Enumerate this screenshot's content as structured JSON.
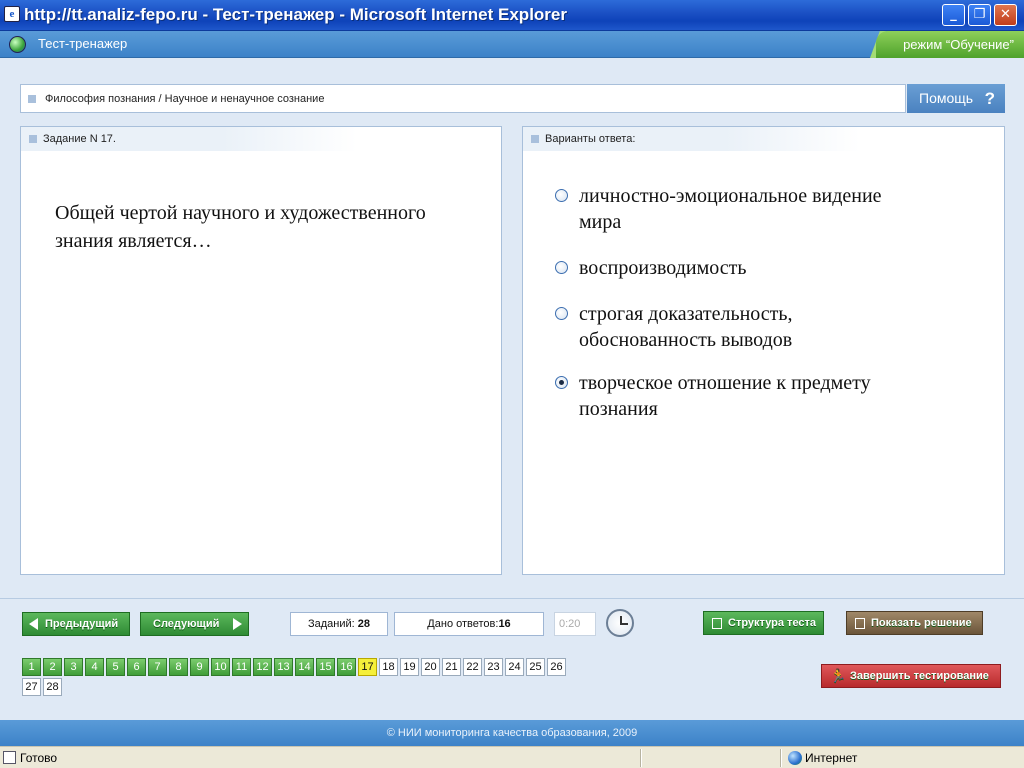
{
  "window": {
    "title": "http://tt.analiz-fepo.ru - Тест-тренажер - Microsoft Internet Explorer",
    "icon": "ie-page-icon"
  },
  "app": {
    "title": "Тест-тренажер",
    "mode": "режим “Обучение”"
  },
  "breadcrumb": "Философия познания / Научное и ненаучное сознание",
  "help_label": "Помощь",
  "help_icon": "?",
  "task": {
    "header": "Задание N 17.",
    "question": "Общей чертой научного и художественного знания является…"
  },
  "answers": {
    "header": "Варианты ответа:",
    "options": [
      {
        "text": "личностно-эмоциональное видение мира",
        "selected": false
      },
      {
        "text": "воспроизводимость",
        "selected": false
      },
      {
        "text": "строгая доказательность, обоснованность выводов",
        "selected": false
      },
      {
        "text": "творческое отношение к предмету познания",
        "selected": true
      }
    ]
  },
  "nav": {
    "prev_label": "Предыдущий",
    "next_label": "Следующий",
    "tasks_label": "Заданий:",
    "tasks_count": "28",
    "answers_label": "Дано ответов:",
    "answers_count": "16",
    "timer": "0:20",
    "structure_label": "Структура теста",
    "solution_label": "Показать решение",
    "finish_label": "Завершить тестирование"
  },
  "pages": [
    "1",
    "2",
    "3",
    "4",
    "5",
    "6",
    "7",
    "8",
    "9",
    "10",
    "11",
    "12",
    "13",
    "14",
    "15",
    "16",
    "17",
    "18",
    "19",
    "20",
    "21",
    "22",
    "23",
    "24",
    "25",
    "26",
    "27",
    "28"
  ],
  "pages_answered_through": 16,
  "current_page": 17,
  "footer": "© НИИ мониторинга качества образования, 2009",
  "status": {
    "left": "Готово",
    "zone": "Интернет"
  },
  "colors": {
    "accent_blue": "#4a82c0",
    "green_button": "#2e8b34",
    "current_page": "#f5ef3a",
    "finish_button": "#b82a2d"
  }
}
